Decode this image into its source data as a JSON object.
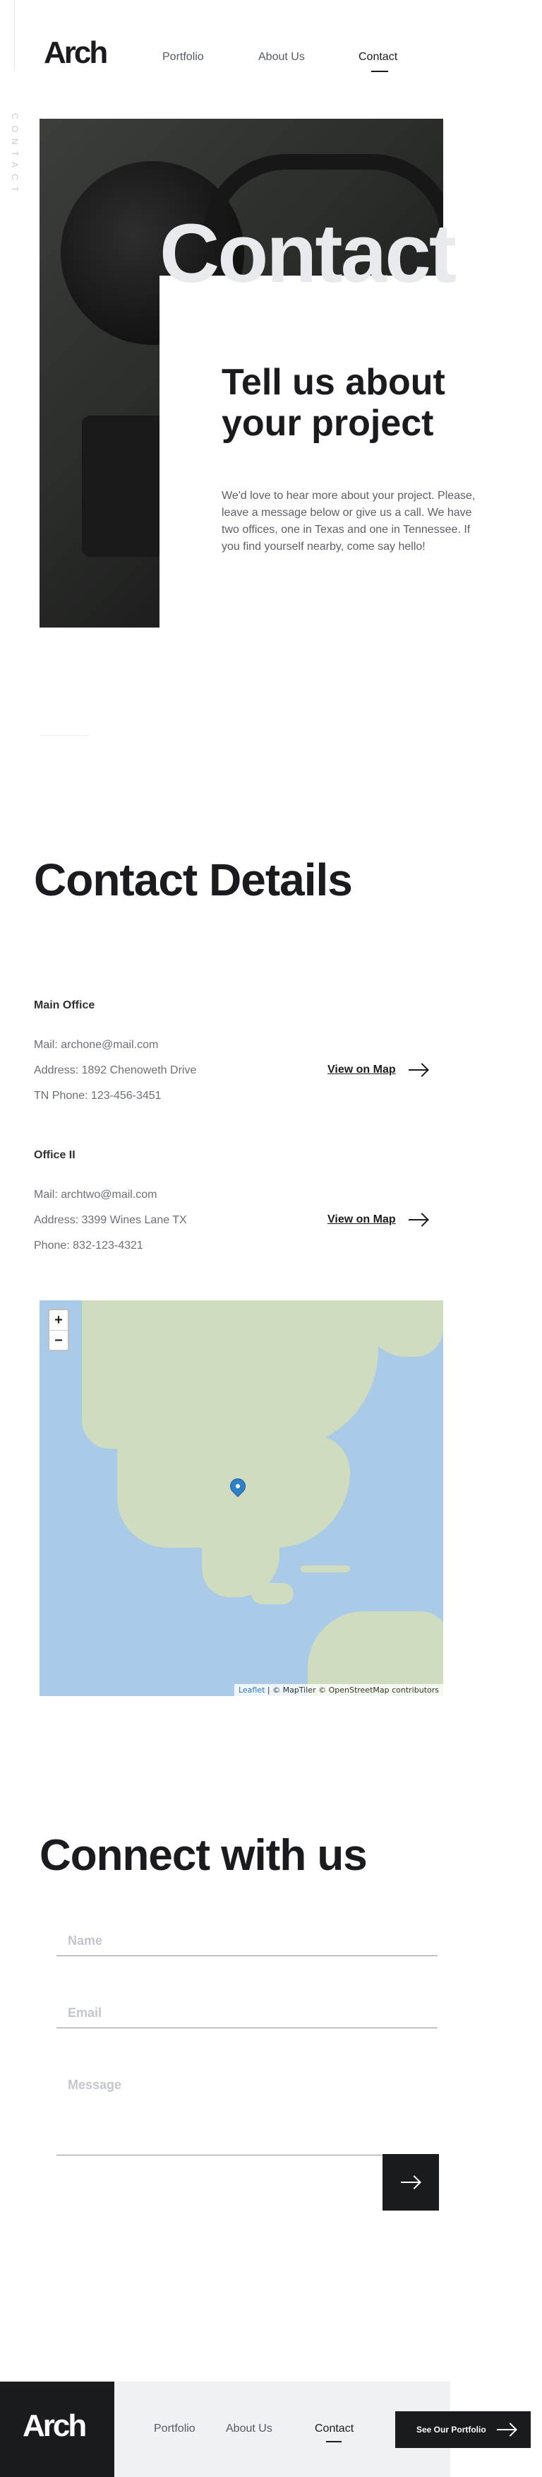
{
  "header": {
    "logo": "Arch",
    "nav": [
      "Portfolio",
      "About Us",
      "Contact"
    ],
    "active_nav": "Contact"
  },
  "side_label": "CONTACT",
  "hero": {
    "big_word": "Contact",
    "heading": "Tell us about your project",
    "paragraph": "We'd love to hear more about your project. Please, leave a message below or give us a call. We have two offices, one in Texas and one in Tennessee. If you find yourself nearby, come say hello!"
  },
  "details": {
    "title": "Contact Details",
    "offices": [
      {
        "name": "Main Office",
        "lines": [
          "Mail: archone@mail.com",
          "Address: 1892 Chenoweth Drive",
          "TN Phone: 123-456-3451"
        ],
        "link": "View on Map"
      },
      {
        "name": "Office II",
        "lines": [
          "Mail: archtwo@mail.com",
          "Address: 3399 Wines Lane TX",
          "Phone: 832-123-4321"
        ],
        "link": "View on Map"
      }
    ]
  },
  "map": {
    "zoom_in": "+",
    "zoom_out": "−",
    "attribution_leaflet": "Leaflet",
    "attribution_rest": "| © MapTiler © OpenStreetMap contributors"
  },
  "connect": {
    "title": "Connect with us",
    "name_placeholder": "Name",
    "email_placeholder": "Email",
    "message_placeholder": "Message"
  },
  "footer": {
    "logo": "Arch",
    "nav": [
      "Portfolio",
      "About Us",
      "Contact"
    ],
    "active_nav": "Contact",
    "portfolio_button": "See Our Portfolio"
  }
}
